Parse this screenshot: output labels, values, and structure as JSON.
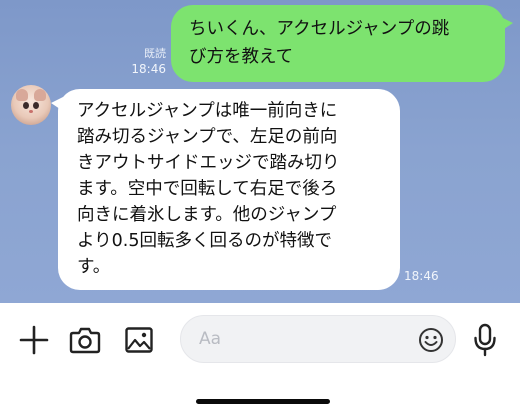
{
  "chat": {
    "outgoing": {
      "text": "ちいくん、アクセルジャンプの跳\nび方を教えて",
      "read_label": "既読",
      "time": "18:46"
    },
    "incoming": {
      "text": "アクセルジャンプは唯一前向きに\n踏み切るジャンプで、左足の前向\nきアウトサイドエッジで踏み切り\nます。空中で回転して右足で後ろ\n向きに着氷します。他のジャンプ\nより0.5回転多く回るのが特徴で\nす。",
      "time": "18:46",
      "avatar_icon": "bear-avatar-icon"
    }
  },
  "input_bar": {
    "placeholder": "Aa",
    "value": "",
    "icons": [
      "plus-icon",
      "camera-icon",
      "image-icon",
      "emoji-icon",
      "microphone-icon"
    ]
  },
  "colors": {
    "chat_background": "#8aa3d0",
    "outgoing_bubble": "#7de36f",
    "incoming_bubble": "#ffffff"
  }
}
